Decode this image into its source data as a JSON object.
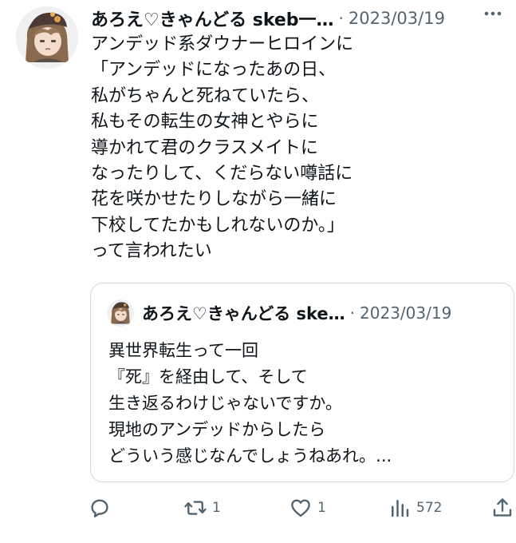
{
  "tweet": {
    "author_name": "あろえ♡きゃんどる skeb一…",
    "separator": "·",
    "date": "2023/03/19",
    "more_icon": "more-icon",
    "body_lines": [
      "アンデッド系ダウナーヒロインに",
      "「アンデッドになったあの日、",
      "私がちゃんと死ねていたら、",
      "私もその転生の女神とやらに",
      "導かれて君のクラスメイトに",
      "なったりして、くだらない噂話に",
      "花を咲かせたりしながら一緒に",
      "下校してたかもしれないのか。」",
      "って言われたい"
    ]
  },
  "quote": {
    "author_name": "あろえ♡きゃんどる ske…",
    "separator": "·",
    "date": "2023/03/19",
    "body_lines": [
      "異世界転生って一回",
      "『死』を経由して、そして",
      "生き返るわけじゃないですか。",
      "現地のアンデッドからしたら",
      "どういう感じなんでしょうねあれ。..."
    ]
  },
  "actions": {
    "reply": {
      "icon": "reply-icon",
      "count": ""
    },
    "retweet": {
      "icon": "retweet-icon",
      "count": "1"
    },
    "like": {
      "icon": "heart-icon",
      "count": "1"
    },
    "views": {
      "icon": "views-icon",
      "count": "572"
    },
    "share": {
      "icon": "share-icon",
      "count": ""
    }
  },
  "colors": {
    "text": "#0f1419",
    "muted": "#536471",
    "border": "#cfd9de"
  }
}
